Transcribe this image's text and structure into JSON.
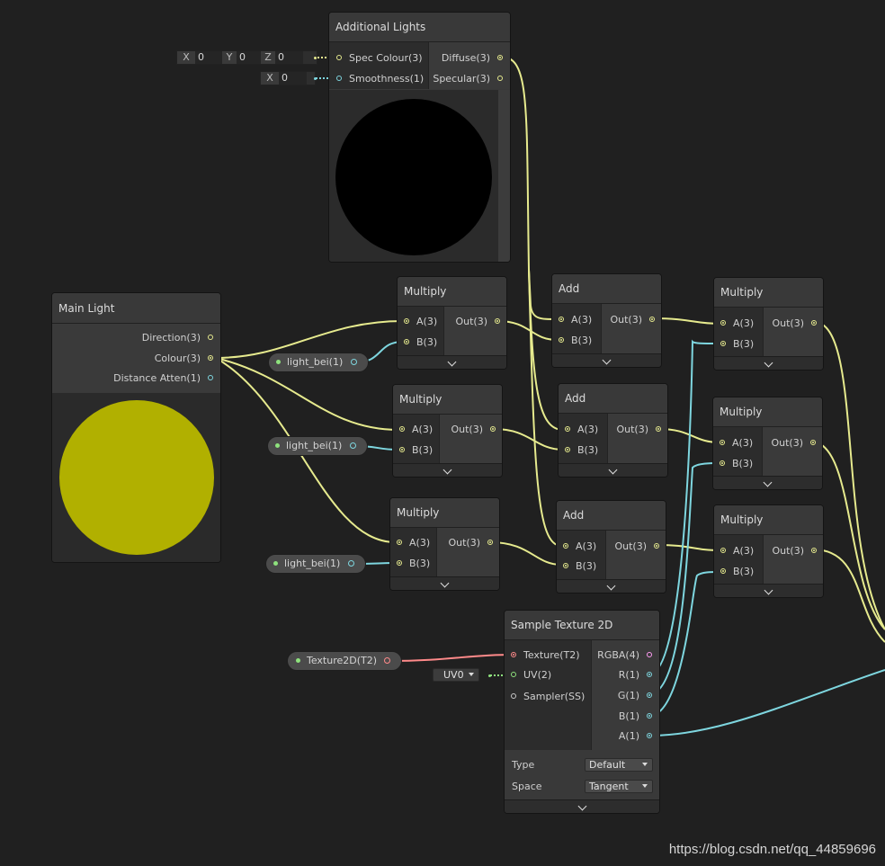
{
  "colors": {
    "vector3": "#e6ea8e",
    "vector1": "#7ed6df",
    "texture": "#ff8a8a",
    "vector4": "#ff9cf3",
    "main_light_preview": "#b1b000",
    "additional_light_preview": "#000000"
  },
  "additional_lights": {
    "title": "Additional Lights",
    "inputs": [
      "Spec Colour(3)",
      "Smoothness(1)"
    ],
    "outputs": [
      "Diffuse(3)",
      "Specular(3)"
    ],
    "spec_fields": [
      {
        "label": "X",
        "value": "0"
      },
      {
        "label": "Y",
        "value": "0"
      },
      {
        "label": "Z",
        "value": "0"
      }
    ],
    "smooth_field": {
      "label": "X",
      "value": "0"
    }
  },
  "main_light": {
    "title": "Main Light",
    "outputs": [
      "Direction(3)",
      "Colour(3)",
      "Distance Atten(1)"
    ]
  },
  "multiply": {
    "title": "Multiply",
    "inputs": [
      "A(3)",
      "B(3)"
    ],
    "output": "Out(3)"
  },
  "add": {
    "title": "Add",
    "inputs": [
      "A(3)",
      "B(3)"
    ],
    "output": "Out(3)"
  },
  "properties": {
    "light_bei": "light_bei(1)",
    "texture": "Texture2D(T2)"
  },
  "sample_texture": {
    "title": "Sample Texture 2D",
    "inputs": [
      "Texture(T2)",
      "UV(2)",
      "Sampler(SS)"
    ],
    "outputs": [
      "RGBA(4)",
      "R(1)",
      "G(1)",
      "B(1)",
      "A(1)"
    ],
    "uv_dropdown": "UV0",
    "type_label": "Type",
    "type_value": "Default",
    "space_label": "Space",
    "space_value": "Tangent"
  },
  "watermark": "https://blog.csdn.net/qq_44859696"
}
